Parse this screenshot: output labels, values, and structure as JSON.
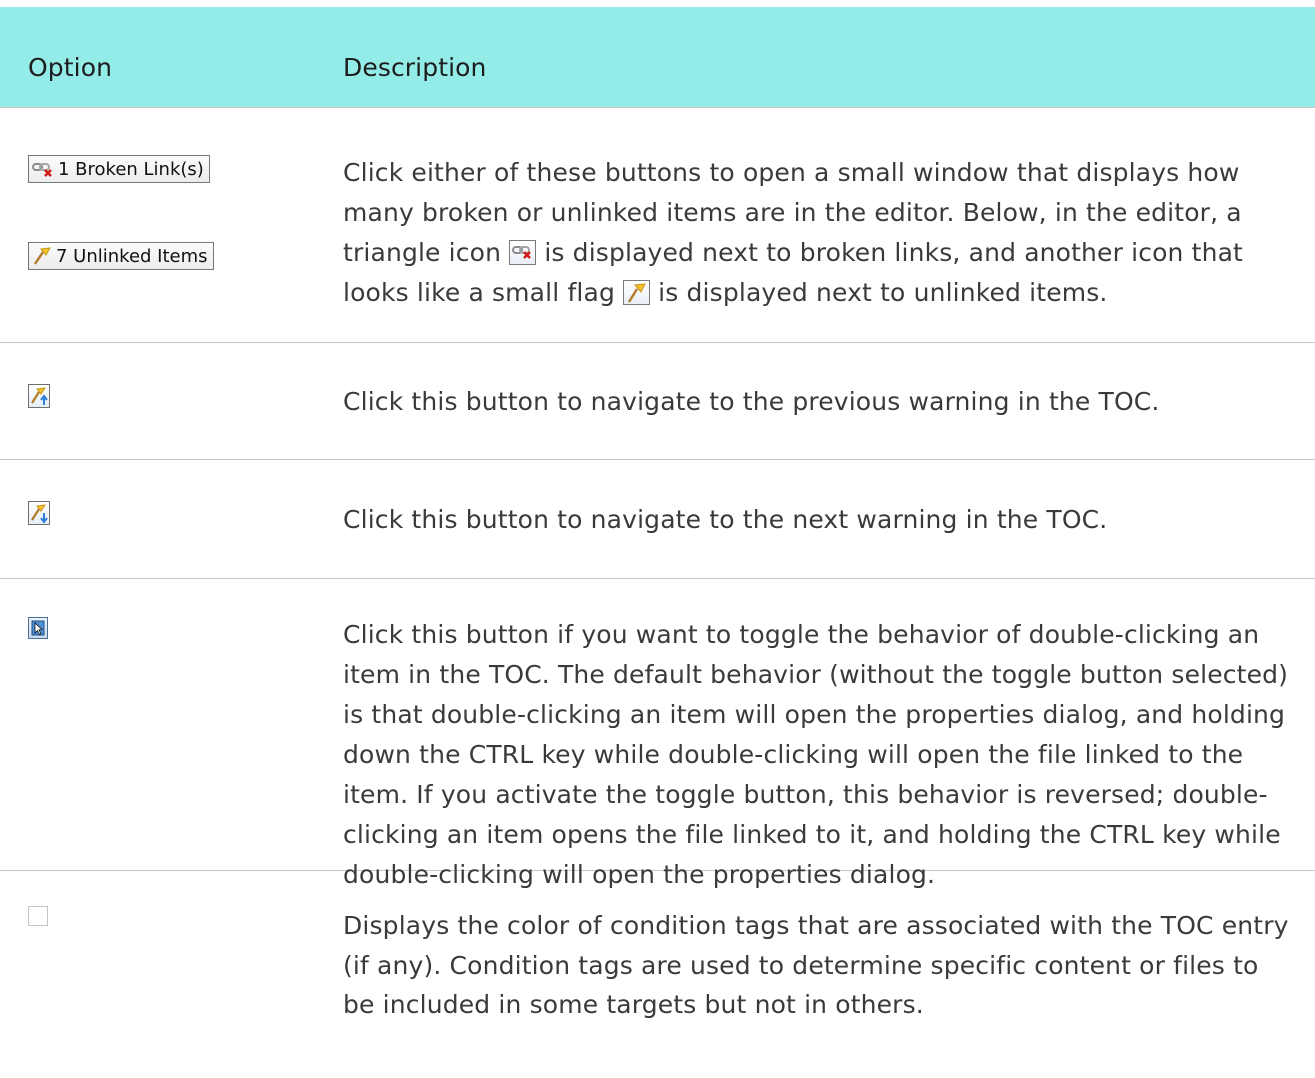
{
  "table": {
    "header": {
      "option": "Option",
      "description": "Description"
    },
    "rows": [
      {
        "options": [
          {
            "icon": "broken-link-icon",
            "label": "1 Broken Link(s)"
          },
          {
            "icon": "unlinked-flag-icon",
            "label": "7 Unlinked Items"
          }
        ],
        "description": {
          "part1": "Click either of these buttons to open a small window that displays how many broken or unlinked items are in the editor. Below, in the editor, a triangle icon ",
          "inline_icon1": "broken-link-icon",
          "part2": " is displayed next to broken links, and another icon that looks like a small flag ",
          "inline_icon2": "unlinked-flag-icon",
          "part3": " is displayed next to unlinked items."
        }
      },
      {
        "options": [
          {
            "icon": "previous-warning-icon"
          }
        ],
        "description": {
          "text": "Click this button to navigate to the previous warning in the TOC."
        }
      },
      {
        "options": [
          {
            "icon": "next-warning-icon"
          }
        ],
        "description": {
          "text": "Click this button to navigate to the next warning in the TOC."
        }
      },
      {
        "options": [
          {
            "icon": "toggle-double-click-icon"
          }
        ],
        "description": {
          "text": "Click this button if you want to toggle the behavior of double-clicking an item in the TOC. The default behavior (without the toggle button selected) is that double-clicking an item will open the properties dialog, and holding down the CTRL key while double-clicking will open the file linked to the item. If you activate the toggle button, this behavior is reversed; double-clicking an item opens the file linked to it, and holding the CTRL key while double-clicking will open the properties dialog."
        }
      },
      {
        "options": [
          {
            "icon": "condition-tag-color-box"
          }
        ],
        "description": {
          "text": "Displays the color of condition tags that are associated with the TOC entry (if any). Condition tags are used to determine specific content or files to be included in some targets but not in others."
        }
      }
    ]
  },
  "colors": {
    "header_bg": "#94ece9",
    "divider": "#c6c6c6",
    "text": "#3a3a3a"
  }
}
